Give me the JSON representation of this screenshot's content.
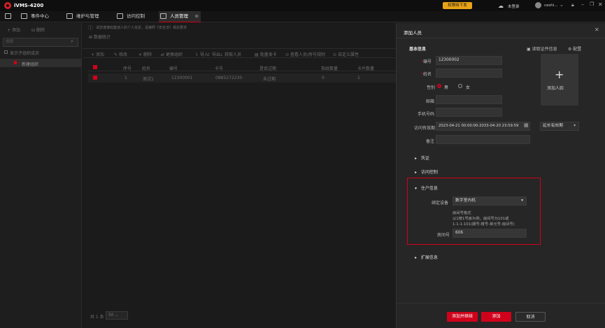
{
  "app": {
    "title": "iVMS-4200",
    "promo": "权限待下发",
    "user_status": "未登录",
    "username": "ceshi..."
  },
  "tabs": [
    {
      "label": "事件中心"
    },
    {
      "label": "维护与管理"
    },
    {
      "label": "访问控制"
    },
    {
      "label": "人员管理"
    }
  ],
  "left": {
    "add_label": "添加",
    "delete_label": "删除",
    "search_placeholder": "搜索",
    "show_sub": "显示子组织成员",
    "org_item": "新建组织"
  },
  "main": {
    "notice": "请您谨慎收集他人的个人信息，请遵照《安全法》相关要求",
    "stats_label": "数据统计",
    "toolbar": [
      "添加",
      "修改",
      "删除",
      "更换组织",
      "导入",
      "导出",
      "获取人员",
      "批量发卡",
      "查看人员/房号规则",
      "自定义属性"
    ],
    "columns": [
      "序号",
      "姓名",
      "编号",
      "卡号",
      "是否过期",
      "指纹数量",
      "卡片数量"
    ],
    "rows": [
      [
        "1",
        "测试1",
        "12300001",
        "0885272230",
        "未过期",
        "0",
        "1"
      ]
    ],
    "footer": {
      "total": "共 1 条",
      "page_size": "50"
    }
  },
  "drawer": {
    "title": "添加人员",
    "section_basic": "基本信息",
    "read_id": "读取证件信息",
    "config": "配置",
    "fields": {
      "id_label": "编号",
      "id_value": "12300002",
      "name_label": "姓名",
      "name_value": "",
      "gender_label": "性别",
      "male": "男",
      "female": "女",
      "email_label": "邮箱",
      "phone_label": "手机号码",
      "valid_label": "访问有效期",
      "valid_value": "2023-04-21 00:00:00-2033-04-20 23:59:59",
      "extend": "延长有效期",
      "remark_label": "备注"
    },
    "add_face": "添加人脸",
    "sections": {
      "credential": "凭证",
      "access": "访问控制",
      "resident": "住户信息",
      "ext": "扩展信息"
    },
    "resident": {
      "device_label": "绑定设备",
      "device_value": "数字室内机",
      "hint_title": "房间号格式",
      "hint_line1": "以1楼1号房为例，房间号为101或",
      "hint_line2": "1-1-1-101(期号-楼号-单元号-房间号)",
      "room_label": "房间号",
      "room_value": "606"
    },
    "buttons": {
      "add_continue": "添加并继续",
      "add": "添加",
      "cancel": "取消"
    }
  },
  "colors": {
    "accent": "#d0021b",
    "promo": "#e8a317",
    "bg": "#1a1a1a"
  }
}
